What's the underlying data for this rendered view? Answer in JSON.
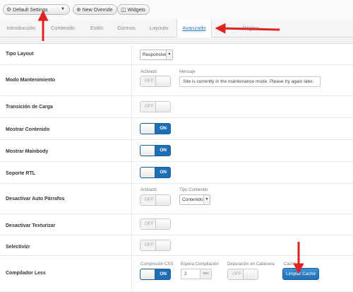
{
  "toolbar": {
    "settings_label": "Default Settings",
    "new_override_label": "New Override",
    "widgets_label": "Widgets"
  },
  "tabs": [
    {
      "label": "Introducción"
    },
    {
      "label": "Contenido"
    },
    {
      "label": "Estilo"
    },
    {
      "label": "Gizmos"
    },
    {
      "label": "Layouts"
    },
    {
      "label": "Avanzado",
      "active": true
    },
    {
      "label": "Página"
    }
  ],
  "rows": {
    "tipo_layout": {
      "label": "Tipo Layout",
      "select_value": "Responsive"
    },
    "modo_mantenimiento": {
      "label": "Modo Mantenimiento",
      "toggle_label": "Activado",
      "toggle": "OFF",
      "message_label": "Mensaje",
      "message_value": "Site is currently in the maintenance mode. Please try again later."
    },
    "transicion_carga": {
      "label": "Transición de Carga",
      "toggle": "OFF"
    },
    "mostrar_contenido": {
      "label": "Mostrar Contenido",
      "toggle": "ON"
    },
    "mostrar_mainbody": {
      "label": "Mostrar Mainbody",
      "toggle": "ON"
    },
    "soporte_rtl": {
      "label": "Soporte RTL",
      "toggle": "ON"
    },
    "desactivar_auto_parrafos": {
      "label": "Desactivar Auto Párrafos",
      "toggle_label": "Activado",
      "toggle": "OFF",
      "tipo_label": "Tipo Contenido",
      "tipo_value": "Contenido"
    },
    "desactivar_texturizar": {
      "label": "Desactivar Texturizar",
      "toggle": "OFF"
    },
    "selectivizr": {
      "label": "Selectivizr",
      "toggle": "OFF"
    },
    "compilador_less": {
      "label": "Compilador Less",
      "compresion_label": "Compresión CSS",
      "compresion_toggle": "ON",
      "espera_label": "Espera Compilación",
      "espera_value": "2",
      "espera_unit": "sec",
      "depuracion_label": "Depuración en Cabecera",
      "depuracion_toggle": "OFF",
      "cache_label": "Caché",
      "cache_button": "Limpiar Caché"
    }
  },
  "colors": {
    "accent": "#1f6fb5",
    "arrow": "#e0231f",
    "active_tab": "#2a7bbf"
  }
}
